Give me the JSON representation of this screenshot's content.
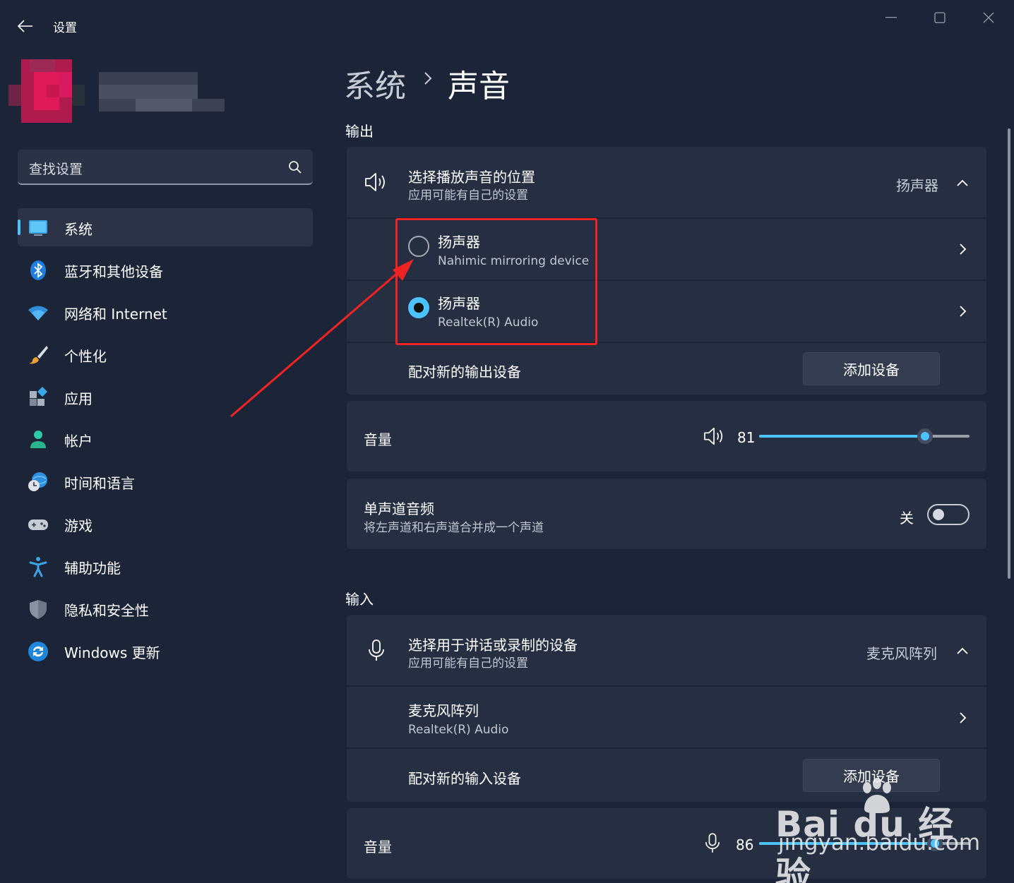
{
  "window": {
    "title": "设置",
    "back_icon": "arrow-left-icon",
    "controls": [
      "minimize-icon",
      "maximize-icon",
      "close-icon"
    ]
  },
  "search": {
    "placeholder": "查找设置",
    "icon": "search-icon"
  },
  "sidebar": {
    "items": [
      {
        "label": "系统",
        "icon": "monitor-icon",
        "active": true
      },
      {
        "label": "蓝牙和其他设备",
        "icon": "bluetooth-icon"
      },
      {
        "label": "网络和 Internet",
        "icon": "wifi-icon"
      },
      {
        "label": "个性化",
        "icon": "brush-icon"
      },
      {
        "label": "应用",
        "icon": "apps-icon"
      },
      {
        "label": "帐户",
        "icon": "account-icon"
      },
      {
        "label": "时间和语言",
        "icon": "globe-clock-icon"
      },
      {
        "label": "游戏",
        "icon": "gamepad-icon"
      },
      {
        "label": "辅助功能",
        "icon": "accessibility-icon"
      },
      {
        "label": "隐私和安全性",
        "icon": "shield-icon"
      },
      {
        "label": "Windows 更新",
        "icon": "update-icon"
      }
    ]
  },
  "breadcrumb": {
    "parent": "系统",
    "current": "声音"
  },
  "output": {
    "section_title": "输出",
    "choose": {
      "title": "选择播放声音的位置",
      "subtitle": "应用可能有自己的设置",
      "value": "扬声器"
    },
    "devices": [
      {
        "name": "扬声器",
        "detail": "Nahimic mirroring device",
        "selected": false
      },
      {
        "name": "扬声器",
        "detail": "Realtek(R) Audio",
        "selected": true
      }
    ],
    "pair": {
      "label": "配对新的输出设备",
      "button": "添加设备"
    },
    "volume": {
      "label": "音量",
      "value": "81",
      "level": 0.81
    },
    "mono": {
      "title": "单声道音频",
      "subtitle": "将左声道和右声道合并成一个声道",
      "state": "关",
      "on": false
    }
  },
  "input": {
    "section_title": "输入",
    "choose": {
      "title": "选择用于讲话或录制的设备",
      "subtitle": "应用可能有自己的设置",
      "value": "麦克风阵列"
    },
    "device": {
      "name": "麦克风阵列",
      "detail": "Realtek(R) Audio"
    },
    "pair": {
      "label": "配对新的输入设备",
      "button": "添加设备"
    },
    "volume": {
      "label": "音量",
      "value": "86",
      "level": 0.86
    }
  },
  "watermark": {
    "logo": "Bai du 经验",
    "url": "jingyan.baidu.com"
  },
  "colors": {
    "accent": "#4cc2ff",
    "annotation": "#ee2424",
    "background": "#1c2438",
    "card": "#262e41"
  }
}
